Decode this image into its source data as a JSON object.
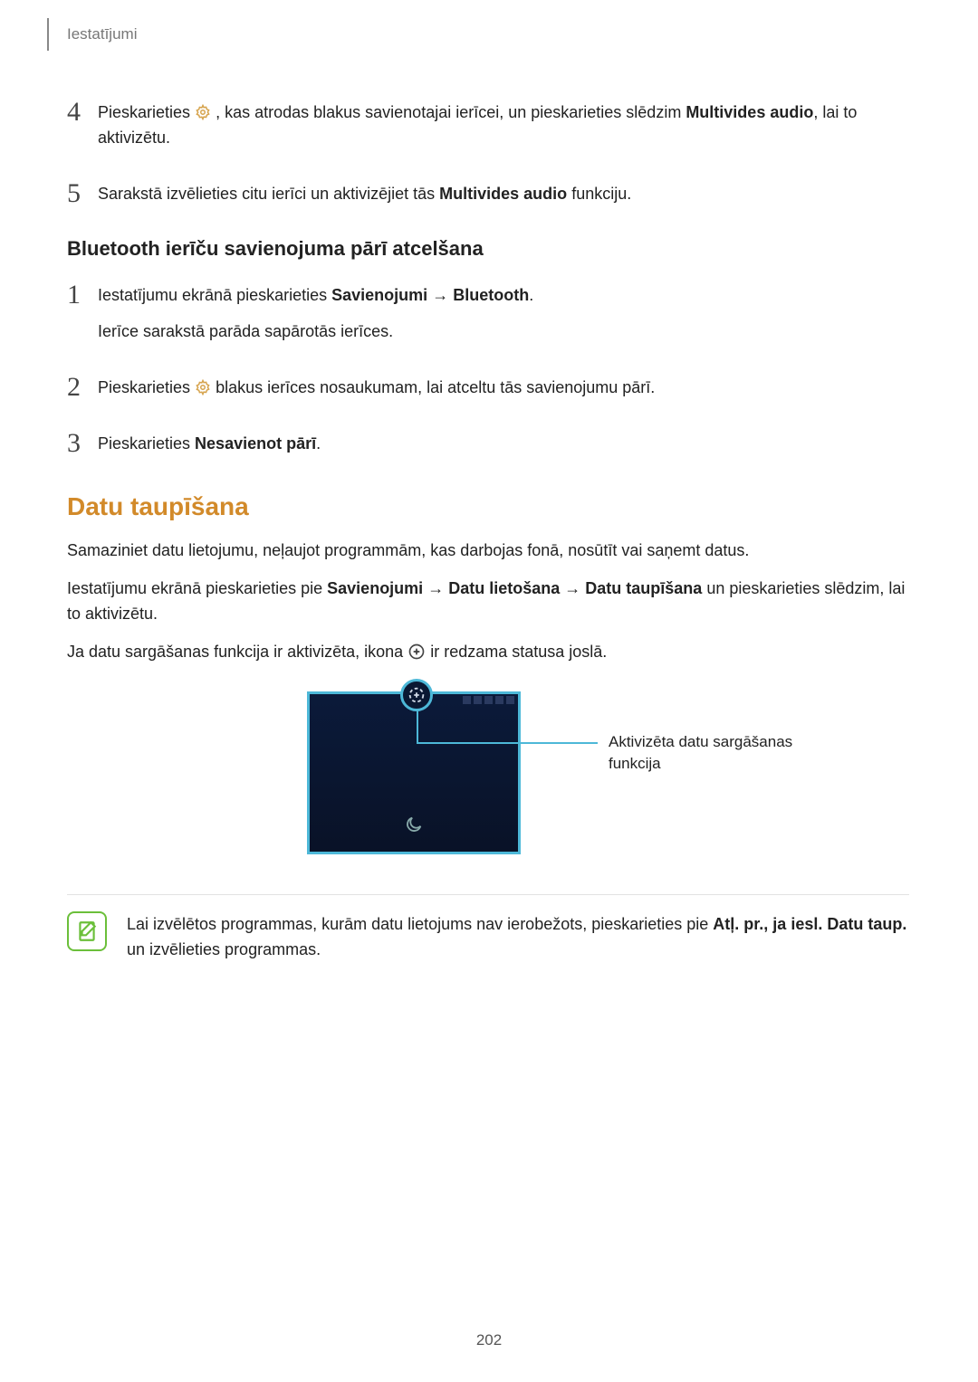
{
  "header": {
    "section": "Iestatījumi"
  },
  "steps_a": {
    "4": {
      "t1": "Pieskarieties ",
      "t2": ", kas atrodas blakus savienotajai ierīcei, un pieskarieties slēdzim ",
      "b1": "Multivides audio",
      "t3": ", lai to aktivizētu."
    },
    "5": {
      "t1": "Sarakstā izvēlieties citu ierīci un aktivizējiet tās ",
      "b1": "Multivides audio",
      "t2": " funkciju."
    }
  },
  "h3": "Bluetooth ierīču savienojuma pārī atcelšana",
  "steps_b": {
    "1": {
      "t1": "Iestatījumu ekrānā pieskarieties ",
      "b1": "Savienojumi",
      "arrow": " → ",
      "b2": "Bluetooth",
      "t2": ".",
      "sub": "Ierīce sarakstā parāda sapārotās ierīces."
    },
    "2": {
      "t1": "Pieskarieties ",
      "t2": " blakus ierīces nosaukumam, lai atceltu tās savienojumu pārī."
    },
    "3": {
      "t1": "Pieskarieties ",
      "b1": "Nesavienot pārī",
      "t2": "."
    }
  },
  "h2": "Datu taupīšana",
  "p1": "Samaziniet datu lietojumu, neļaujot programmām, kas darbojas fonā, nosūtīt vai saņemt datus.",
  "p2": {
    "t1": "Iestatījumu ekrānā pieskarieties pie ",
    "b1": "Savienojumi",
    "arrow": " → ",
    "b2": "Datu lietošana",
    "b3": "Datu taupīšana",
    "t2": " un pieskarieties slēdzim, lai to aktivizētu."
  },
  "p3": {
    "t1": "Ja datu sargāšanas funkcija ir aktivizēta, ikona ",
    "t2": " ir redzama statusa joslā."
  },
  "callout": "Aktivizēta datu sargāšanas funkcija",
  "note": {
    "t1": "Lai izvēlētos programmas, kurām datu lietojums nav ierobežots, pieskarieties pie ",
    "b1": "Atļ. pr., ja iesl. Datu taup.",
    "t2": " un izvēlieties programmas."
  },
  "pagenum": "202",
  "steps_a_nums": {
    "n4": "4",
    "n5": "5"
  },
  "steps_b_nums": {
    "n1": "1",
    "n2": "2",
    "n3": "3"
  }
}
